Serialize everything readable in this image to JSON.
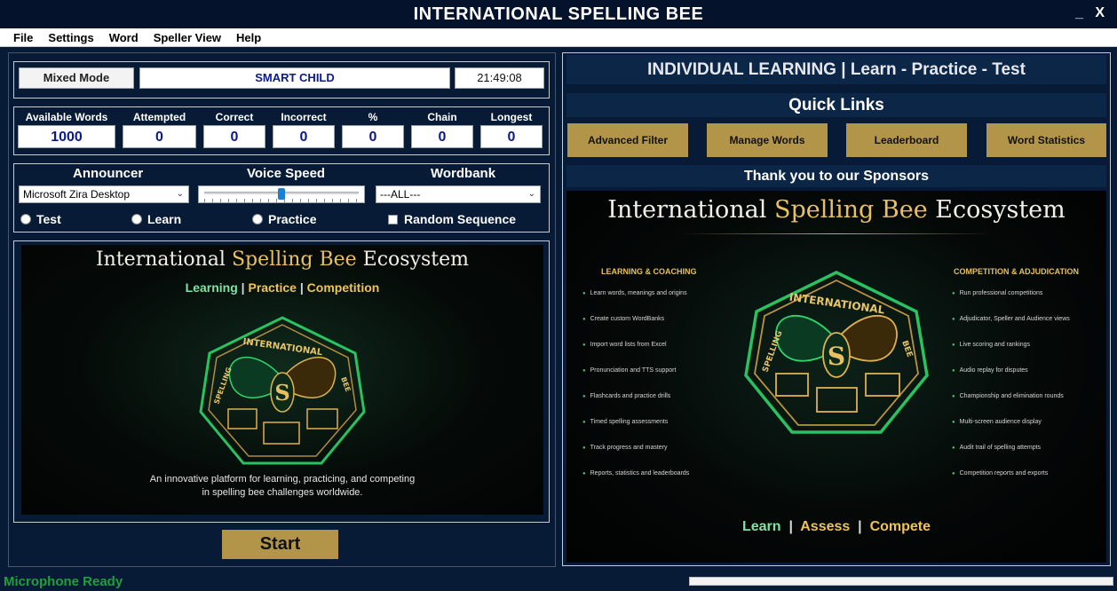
{
  "window": {
    "title": "INTERNATIONAL SPELLING BEE",
    "minimize": "_",
    "close": "X"
  },
  "menu": [
    "File",
    "Settings",
    "Word",
    "Speller View",
    "Help"
  ],
  "session": {
    "mode": "Mixed Mode",
    "speller": "SMART CHILD",
    "clock": "21:49:08"
  },
  "stats": [
    {
      "label": "Available Words",
      "value": "1000"
    },
    {
      "label": "Attempted",
      "value": "0"
    },
    {
      "label": "Correct",
      "value": "0"
    },
    {
      "label": "Incorrect",
      "value": "0"
    },
    {
      "label": "%",
      "value": "0"
    },
    {
      "label": "Chain",
      "value": "0"
    },
    {
      "label": "Longest",
      "value": "0"
    }
  ],
  "voice": {
    "announcer_label": "Announcer",
    "announcer_value": "Microsoft Zira Desktop",
    "speed_label": "Voice Speed",
    "speed_level": 0.5,
    "wordbank_label": "Wordbank",
    "wordbank_value": "---ALL---"
  },
  "options": {
    "test": "Test",
    "learn": "Learn",
    "practice": "Practice",
    "random": "Random Sequence"
  },
  "banner": {
    "title_a": "International ",
    "title_b": "Spelling Bee",
    "title_c": " Ecosystem",
    "tag_1": "Learning",
    "tag_2": "Practice",
    "tag_3": "Competition",
    "desc_1": "An innovative platform for learning, practicing, and competing",
    "desc_2": "in spelling bee challenges worldwide."
  },
  "start_label": "Start",
  "right": {
    "heading": "INDIVIDUAL LEARNING | Learn - Practice - Test",
    "quick_links": "Quick Links",
    "links": [
      "Advanced Filter",
      "Manage Words",
      "Leaderboard",
      "Word Statistics"
    ],
    "sponsors": "Thank you to our Sponsors"
  },
  "sponsor_art": {
    "title_a": "International ",
    "title_b": "Spelling Bee",
    "title_c": " Ecosystem",
    "left_heading": "LEARNING & COACHING",
    "left_items": [
      "Learn words, meanings and origins",
      "Create custom WordBanks",
      "Import word lists from Excel",
      "Pronunciation and TTS support",
      "Flashcards and practice drills",
      "Timed spelling assessments",
      "Track progress and mastery",
      "Reports, statistics and leaderboards"
    ],
    "right_heading": "COMPETITION & ADJUDICATION",
    "right_items": [
      "Run professional competitions",
      "Adjudicator, Speller and Audience views",
      "Live scoring and rankings",
      "Audio replay for disputes",
      "Championship and elimination rounds",
      "Multi-screen audience display",
      "Audit trail of spelling attempts",
      "Competition reports and exports"
    ],
    "bottom_1": "Learn",
    "bottom_2": "Assess",
    "bottom_3": "Compete"
  },
  "emblem": {
    "top": "INTERNATIONAL",
    "left": "SPELLING",
    "right": "BEE",
    "center": "S"
  },
  "status": "Microphone Ready",
  "colors": {
    "gold": "#b3954a",
    "navy": "#071a36",
    "ready": "#1fa03a"
  }
}
